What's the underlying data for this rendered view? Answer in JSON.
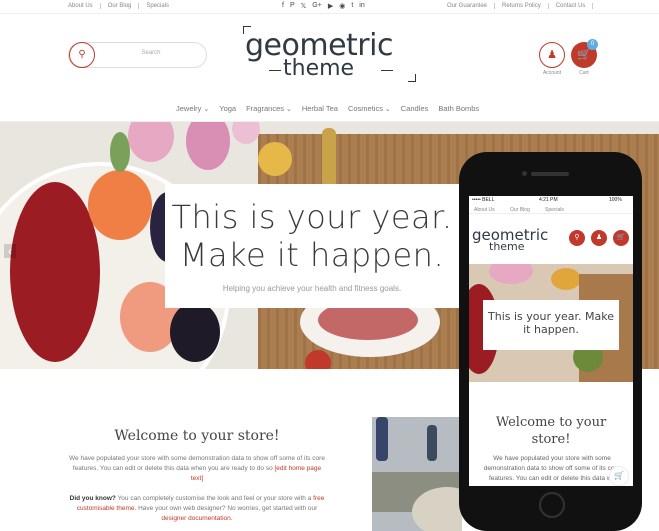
{
  "topbar": {
    "links": [
      "About Us",
      "Our Blog",
      "Specials"
    ],
    "social_icons": [
      "facebook-icon",
      "pinterest-icon",
      "twitter-icon",
      "google-plus-icon",
      "youtube-icon",
      "instagram-icon",
      "tumblr-icon",
      "linkedin-icon"
    ],
    "right_links": [
      "Our Guarantee",
      "Returns Policy",
      "Contact Us"
    ]
  },
  "header": {
    "search_placeholder": "Search",
    "logo_line1": "geometric",
    "logo_line2": "theme",
    "account_label": "Account",
    "cart_label": "Cart",
    "cart_count": "0"
  },
  "nav": {
    "items": [
      {
        "label": "Jewelry",
        "dropdown": true
      },
      {
        "label": "Yoga",
        "dropdown": false
      },
      {
        "label": "Fragrances",
        "dropdown": true
      },
      {
        "label": "Herbal Tea",
        "dropdown": false
      },
      {
        "label": "Cosmetics",
        "dropdown": true
      },
      {
        "label": "Candles",
        "dropdown": false
      },
      {
        "label": "Bath Bombs",
        "dropdown": false
      }
    ]
  },
  "hero": {
    "line1": "This is your year.",
    "line2": "Make it happen.",
    "subtitle": "Helping you achieve your health and fitness goals."
  },
  "welcome": {
    "title": "Welcome to your store!",
    "p1_a": "We have populated your store with some demonstration data to show off some of its core features. You can edit or delete this data when you are ready to do so ",
    "p1_link": "[edit home page text]",
    "p2_bold": "Did you know?",
    "p2_a": " You can completely customise the look and feel or your store with a ",
    "p2_link": "free customisable theme",
    "p2_b": ". Have your own web designer? No worries, get started with our ",
    "p2_link2": "designer documentation",
    "p2_c": "."
  },
  "phone": {
    "carrier": "••••• BELL",
    "time": "4:21 PM",
    "battery": "100%",
    "top_links": [
      "About Us",
      "Our Blog",
      "Specials"
    ],
    "logo_line1": "geometric",
    "logo_line2": "theme",
    "hero_line1": "This is your year. Make",
    "hero_line2": "it happen.",
    "welcome_line1": "Welcome to your",
    "welcome_line2": "store!",
    "text": "We have populated your store with some demonstration data to show off some of its core features. You can edit or delete this data wh"
  },
  "colors": {
    "accent": "#c0392b",
    "logo": "#2f3a44",
    "badge": "#5dade2"
  }
}
